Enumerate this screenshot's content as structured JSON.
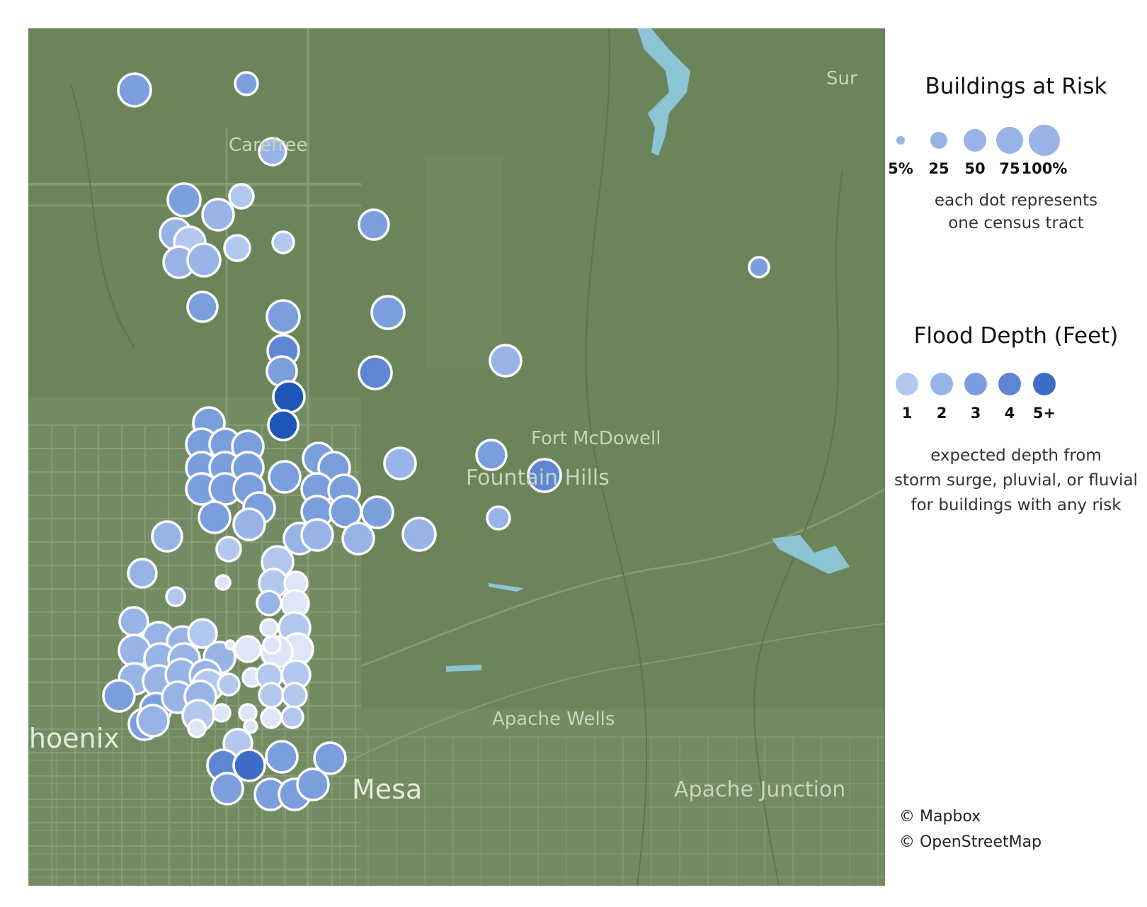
{
  "map": {
    "places": [
      {
        "id": "carefree",
        "label": "Carefree",
        "size": "small",
        "color": "#c9d3bd"
      },
      {
        "id": "fort-mcdowell",
        "label": "Fort McDowell",
        "size": "small",
        "color": "#c9d3bd"
      },
      {
        "id": "fountain-hills",
        "label": "Fountain Hills",
        "size": "small",
        "color": "#c9d3bd"
      },
      {
        "id": "apache-wells",
        "label": "Apache Wells",
        "size": "small",
        "color": "#c9d3bd"
      },
      {
        "id": "phoenix",
        "label": "Phoenix",
        "size": "big",
        "color": "#e4eadc"
      },
      {
        "id": "mesa",
        "label": "Mesa",
        "size": "big",
        "color": "#e4eadc"
      },
      {
        "id": "apache-junction",
        "label": "Apache Junction",
        "size": "small",
        "color": "#c9d3bd"
      },
      {
        "id": "sun",
        "label": "Sur",
        "size": "small",
        "color": "#c9d3bd"
      }
    ],
    "colors": {
      "land": "#6b8459",
      "roads": "#8ea07c",
      "water": "#8dc4d4",
      "dot_stroke": "#ffffff"
    }
  },
  "legend": {
    "size_title": "Buildings at Risk",
    "size_items": [
      {
        "label": "5%",
        "value": 5
      },
      {
        "label": "25",
        "value": 25
      },
      {
        "label": "50",
        "value": 50
      },
      {
        "label": "75",
        "value": 75
      },
      {
        "label": "100%",
        "value": 100
      }
    ],
    "size_note_1": "each dot represents",
    "size_note_2": "one census tract",
    "color_title": "Flood Depth (Feet)",
    "color_items": [
      {
        "label": "1",
        "color": "#b3c8ef"
      },
      {
        "label": "2",
        "color": "#98b4e6"
      },
      {
        "label": "3",
        "color": "#7b9fdd"
      },
      {
        "label": "4",
        "color": "#5e86d2"
      },
      {
        "label": "5+",
        "color": "#3f6cc7"
      }
    ],
    "color_note_1": "expected depth from",
    "color_note_2": "storm surge, pluvial, or fluvial",
    "color_note_3": "for buildings with any risk"
  },
  "attribution": {
    "line1": "© Mapbox",
    "line2": "© OpenStreetMap"
  }
}
